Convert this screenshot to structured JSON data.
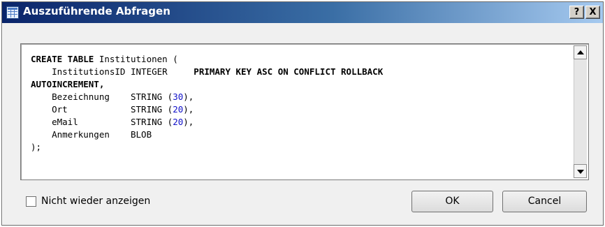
{
  "dialog": {
    "title": "Auszuführende Abfragen",
    "help_label": "?",
    "close_label": "X"
  },
  "query": {
    "lines": [
      [
        {
          "t": "CREATE TABLE",
          "s": "kw"
        },
        {
          "t": " Institutionen (",
          "s": ""
        }
      ],
      [
        {
          "t": "    InstitutionsID INTEGER     ",
          "s": ""
        },
        {
          "t": "PRIMARY KEY ASC ON CONFLICT ROLLBACK",
          "s": "kw"
        }
      ],
      [
        {
          "t": "AUTOINCREMENT,",
          "s": "kw"
        }
      ],
      [
        {
          "t": "    Bezeichnung    STRING (",
          "s": ""
        },
        {
          "t": "30",
          "s": "num"
        },
        {
          "t": "),",
          "s": ""
        }
      ],
      [
        {
          "t": "    Ort            STRING (",
          "s": ""
        },
        {
          "t": "20",
          "s": "num"
        },
        {
          "t": "),",
          "s": ""
        }
      ],
      [
        {
          "t": "    eMail          STRING (",
          "s": ""
        },
        {
          "t": "20",
          "s": "num"
        },
        {
          "t": "),",
          "s": ""
        }
      ],
      [
        {
          "t": "    Anmerkungen    BLOB",
          "s": ""
        }
      ],
      [
        {
          "t": ");",
          "s": ""
        }
      ]
    ]
  },
  "footer": {
    "checkbox_label": "Nicht wieder anzeigen",
    "checkbox_checked": false,
    "ok_label": "OK",
    "cancel_label": "Cancel"
  },
  "colors": {
    "titlebar_start": "#0a246a",
    "titlebar_end": "#a6caf0",
    "number_literal": "#1010c8"
  }
}
